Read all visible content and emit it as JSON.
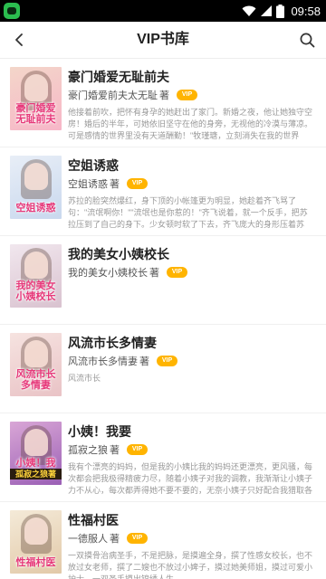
{
  "status_bar": {
    "time": "09:58"
  },
  "header": {
    "title": "VIP书库"
  },
  "books": [
    {
      "title": "豪门婚爱无耻前夫",
      "author": "豪门婚爱前夫太无耻",
      "author_suffix": "著",
      "badge": "VIP",
      "description": "他接着前吹，把怀有身孕的她赶出了家门。新婚之夜，他让她独守空房！婚后的半年，可她依旧坚守在他的身旁，无视他的冷漠与薄凉。可是感情的世界里没有天道酬勤！\"牧瑾瑭，立刻消失在我的世界里。\"",
      "cover_text": "豪门婚爱无耻前夫",
      "cover_colors": [
        "#f3d6c9",
        "#f7b6c8"
      ]
    },
    {
      "title": "空姐诱惑",
      "author": "空姐诱惑",
      "author_suffix": "著",
      "badge": "VIP",
      "description": "苏拉的脸突然爆红，身下顶的小帐篷更为明显，她趁着齐飞骂了句：\"流氓啊你！\"\"流氓也是你惹的！\"齐飞说着，就一个反手，把苏拉压到了自己的身下。少女顿时软了下去，齐飞庞大的身形压着苏拉，把苏拉禁锢在...",
      "cover_text": "空姐诱惑",
      "cover_colors": [
        "#e8eef7",
        "#c9d8ee"
      ]
    },
    {
      "title": "我的美女小姨校长",
      "author": "我的美女小姨校长",
      "author_suffix": "著",
      "badge": "VIP",
      "description": "",
      "cover_text": "我的美女小姨校长",
      "cover_colors": [
        "#f1e7ee",
        "#d9c2cf"
      ]
    },
    {
      "title": "风流市长多情妻",
      "author": "风流市长多情妻",
      "author_suffix": "著",
      "badge": "VIP",
      "description": "风流市长",
      "cover_text": "风流市长多情妻",
      "cover_colors": [
        "#f6e3e0",
        "#e9c3c6"
      ]
    },
    {
      "title": "小姨！我要",
      "author": "孤寂之狼",
      "author_suffix": "著",
      "badge": "VIP",
      "description": "我有个漂亮的妈妈，但是我的小姨比我的妈妈还更漂亮，更风骚，每次都会把我极得精疲力尽，随着小姨子对我的调教，我渐渐让小姨子力不从心，每次都弄得她不要不要的，无奈小姨子只好配合我猎取各类美女，...",
      "cover_text": "小姨！我要",
      "cover_banner": "孤寂之狼著",
      "cover_colors": [
        "#d9a6d6",
        "#9a5fb5"
      ]
    },
    {
      "title": "性福村医",
      "author": "一德服人",
      "author_suffix": "著",
      "badge": "VIP",
      "description": "一双摸骨治病圣手，不是把脉，是摸遍全身，撰了性感女校长，也不放过女老师，撰了二嫂也不放过小婢子，摸过她美师姐，摸过可爱小护士，一双圣手摸出锦绣人生。",
      "cover_text": "性福村医",
      "cover_colors": [
        "#f4ead8",
        "#e2c9a8"
      ]
    }
  ]
}
